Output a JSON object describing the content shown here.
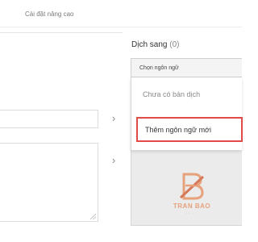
{
  "tabs": {
    "advanced_label": "Cài đặt nâng cao"
  },
  "target": {
    "label": "Dịch sang",
    "count": "(0)",
    "select_placeholder": "Chọn ngôn ngữ",
    "dropdown": {
      "no_translation": "Chưa có bản dịch",
      "add_language": "Thêm ngôn ngữ mới"
    }
  },
  "controls": {
    "chevron_glyph": "›"
  },
  "watermark": {
    "brand": "TRAN BAO",
    "accent_color": "#e7a27c"
  }
}
